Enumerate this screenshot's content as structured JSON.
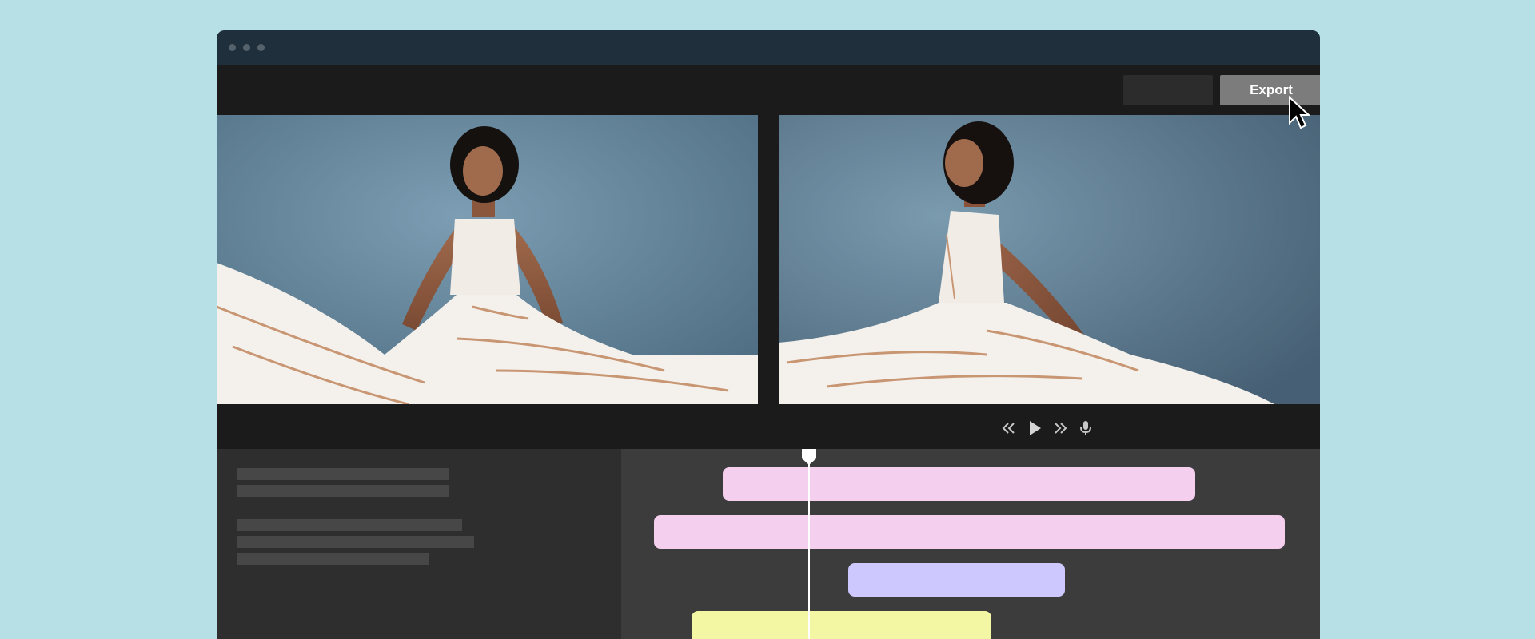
{
  "window": {
    "titlebar_dots": [
      "window-dot-1",
      "window-dot-2",
      "window-dot-3"
    ]
  },
  "toolbar": {
    "export_label": "Export"
  },
  "viewers": {
    "left_icon": "photo-woman-white-dress-seated",
    "right_icon": "photo-woman-white-dress-smiling"
  },
  "controls": {
    "icons": [
      "rewind-icon",
      "play-icon",
      "fast-forward-icon",
      "microphone-icon"
    ]
  },
  "timeline": {
    "clip_colors": {
      "pink": "#f5cfee",
      "lavender": "#cdc9ff",
      "yellow": "#f3f6a3"
    }
  },
  "colors": {
    "page_background": "#b6dfe6",
    "titlebar": "#1f2f3c",
    "export_button": "#7c7c7c"
  }
}
